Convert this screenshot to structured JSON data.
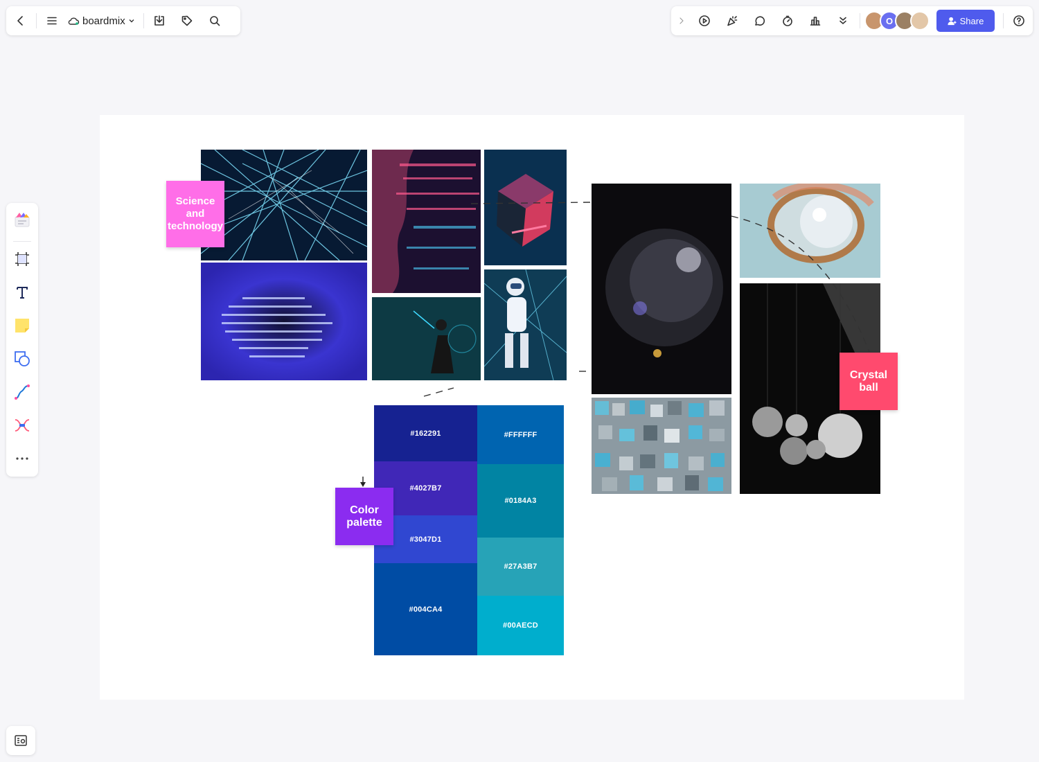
{
  "app": {
    "name": "boardmix"
  },
  "toolbar": {
    "share_label": "Share"
  },
  "collaborators": [
    {
      "initial": "",
      "color": "#c8956d"
    },
    {
      "initial": "O",
      "color": "#6a6ff0"
    },
    {
      "initial": "",
      "color": "#9b8064"
    },
    {
      "initial": "",
      "color": "#e3c7a8"
    }
  ],
  "stickies": {
    "science": {
      "text": "Science and technology",
      "color": "#ff6ee8"
    },
    "crystal": {
      "text": "Crystal ball",
      "color": "#ff4a6e"
    },
    "palette": {
      "text": "Color palette",
      "color": "#8b2cf0"
    }
  },
  "palette": {
    "left": [
      {
        "label": "#162291",
        "color": "#162291"
      },
      {
        "label": "#4027B7",
        "color": "#4027B7"
      },
      {
        "label": "#3047D1",
        "color": "#3047D1"
      },
      {
        "label": "#004CA4",
        "color": "#004CA4"
      }
    ],
    "right": [
      {
        "label": "#FFFFFF",
        "color": "#0064B0"
      },
      {
        "label": "#0184A3",
        "color": "#0184A3"
      },
      {
        "label": "#27A3B7",
        "color": "#27A3B7"
      },
      {
        "label": "#00AECD",
        "color": "#00AECD"
      }
    ]
  }
}
